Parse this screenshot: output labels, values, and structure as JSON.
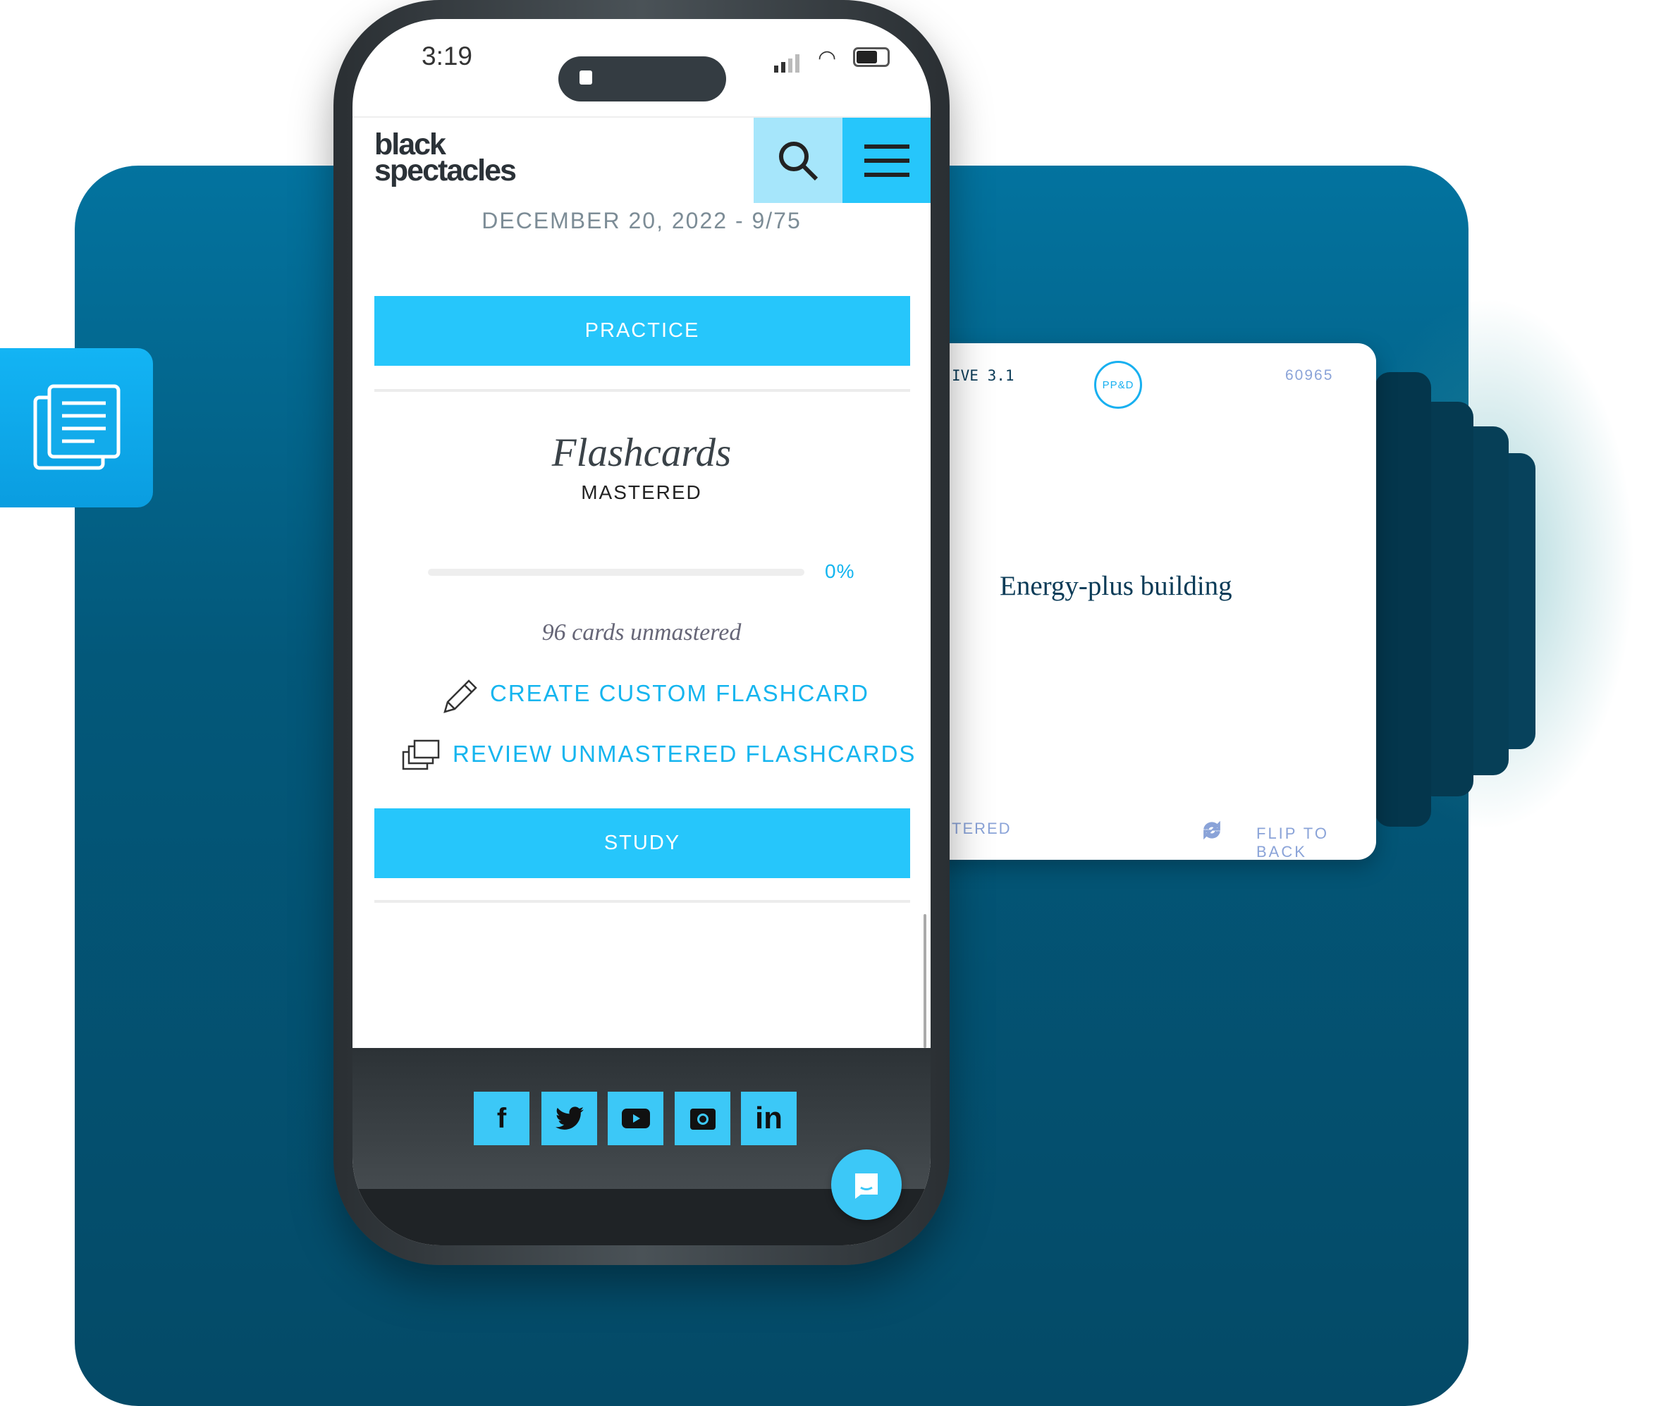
{
  "status_bar": {
    "time": "3:19"
  },
  "header": {
    "logo_line1": "black",
    "logo_line2": "spectacles",
    "date_progress": "DECEMBER 20, 2022 - 9/75"
  },
  "main": {
    "practice_label": "PRACTICE",
    "flashcards_title": "Flashcards",
    "mastered_label": "MASTERED",
    "mastered_percent": "0%",
    "mastered_fraction": 0,
    "unmastered_count": "96 cards unmastered",
    "create_link": "CREATE CUSTOM FLASHCARD",
    "review_link": "REVIEW UNMASTERED FLASHCARDS",
    "study_label": "STUDY"
  },
  "footer": {
    "social": [
      "facebook",
      "twitter",
      "youtube",
      "instagram",
      "linkedin"
    ]
  },
  "flashcard": {
    "section": "IVE 3.1",
    "badge": "PP&D",
    "card_id": "60965",
    "term": "Energy-plus building",
    "status": "TERED",
    "flip_label": "FLIP TO BACK"
  },
  "colors": {
    "accent": "#26c6fb",
    "panel": "#03587a",
    "link": "#15b5ef"
  }
}
